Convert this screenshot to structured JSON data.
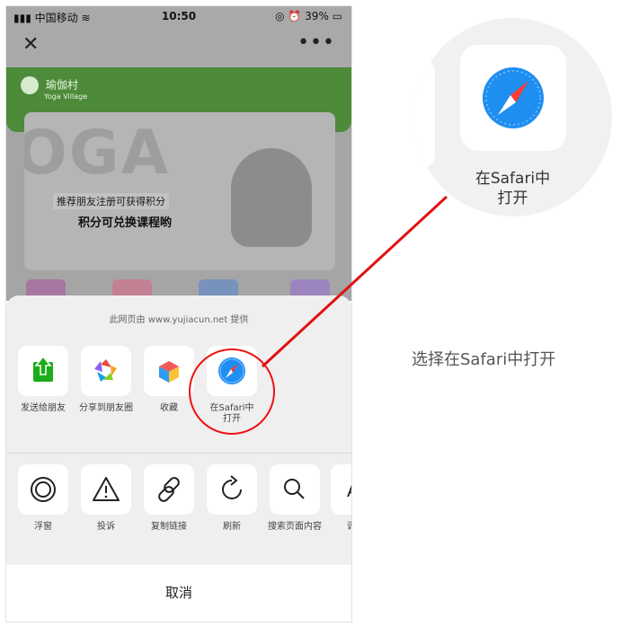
{
  "status_bar": {
    "carrier": "中国移动",
    "time": "10:50",
    "battery": "39%"
  },
  "navbar": {
    "close_icon": "close-icon",
    "more_icon": "more-icon"
  },
  "webpage": {
    "logo_text": "瑜伽村",
    "logo_sub": "Yoga Village",
    "banner_big": "OGA",
    "promo_line1": "推荐朋友注册可获得积分",
    "promo_line2": "积分可兑换课程哟"
  },
  "share_sheet": {
    "provider": "此网页由 www.yujiacun.net 提供",
    "row1": [
      {
        "label": "发送给朋友",
        "icon": "share-to-friend-icon"
      },
      {
        "label": "分享到朋友圈",
        "icon": "moments-icon"
      },
      {
        "label": "收藏",
        "icon": "favorite-cube-icon"
      },
      {
        "label_line1": "在Safari中",
        "label_line2": "打开",
        "icon": "safari-icon"
      }
    ],
    "row2": [
      {
        "label": "浮窗",
        "icon": "float-window-icon"
      },
      {
        "label": "投诉",
        "icon": "warning-icon"
      },
      {
        "label": "复制链接",
        "icon": "link-icon"
      },
      {
        "label": "刷新",
        "icon": "refresh-icon"
      },
      {
        "label": "搜索页面内容",
        "icon": "search-icon"
      },
      {
        "label": "调整",
        "icon": "font-adjust-icon"
      }
    ],
    "cancel": "取消"
  },
  "callout": {
    "zoom_label_line1": "在Safari中",
    "zoom_label_line2": "打开",
    "caption": "选择在Safari中打开"
  },
  "colors": {
    "accent_red": "#e11111",
    "green_banner": "#4d8a3a",
    "wechat_green": "#1aad19"
  }
}
